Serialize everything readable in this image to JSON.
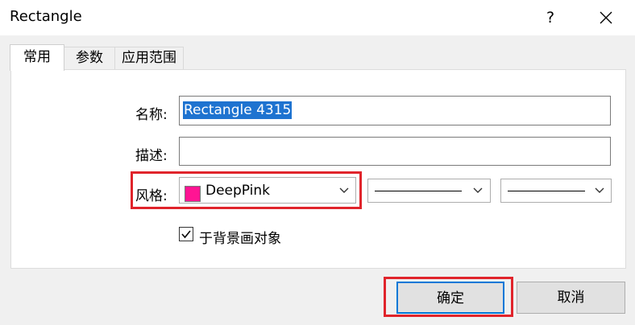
{
  "window": {
    "title": "Rectangle",
    "help_label": "?",
    "close_icon": "close-icon"
  },
  "tabs": [
    {
      "label": "常用",
      "active": true
    },
    {
      "label": "参数",
      "active": false
    },
    {
      "label": "应用范围",
      "active": false
    }
  ],
  "form": {
    "name_label": "名称:",
    "name_value": "Rectangle 4315",
    "description_label": "描述:",
    "description_value": "",
    "style_label": "风格:",
    "color_name": "DeepPink",
    "color_hex": "#ff1493",
    "background_checkbox_label": "于背景画对象",
    "background_checked": true
  },
  "buttons": {
    "ok_label": "确定",
    "cancel_label": "取消"
  },
  "colors": {
    "highlight": "#e0242b",
    "selection": "#1e73d0",
    "default_button_border": "#0078d7"
  }
}
